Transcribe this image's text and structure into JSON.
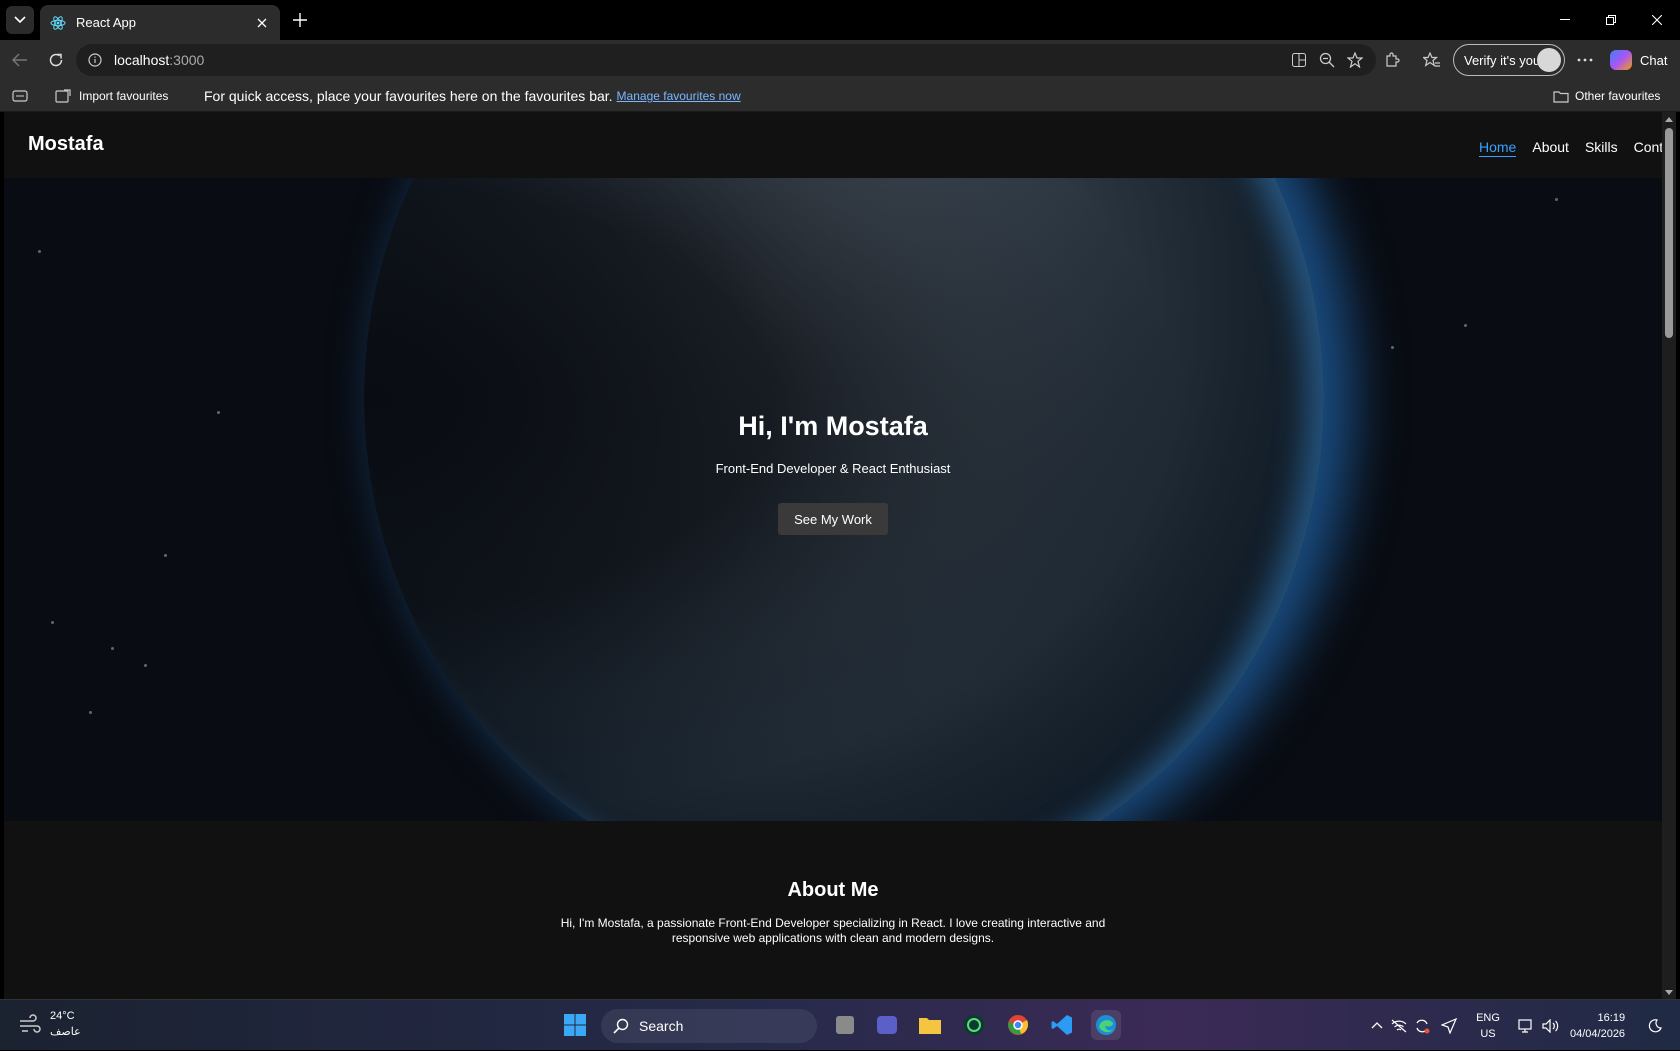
{
  "browser": {
    "tab_title": "React App",
    "url_host": "localhost",
    "url_port": ":3000",
    "verify_label": "Verify it's you",
    "chat_label": "Chat"
  },
  "favbar": {
    "import_label": "Import favourites",
    "message": "For quick access, place your favourites here on the favourites bar.",
    "manage_link": "Manage favourites now",
    "other_label": "Other favourites"
  },
  "page": {
    "brand": "Mostafa",
    "nav": [
      {
        "label": "Home",
        "active": true
      },
      {
        "label": "About",
        "active": false
      },
      {
        "label": "Skills",
        "active": false
      },
      {
        "label": "Contact",
        "active": false
      }
    ],
    "hero": {
      "title": "Hi, I'm Mostafa",
      "subtitle": "Front-End Developer & React Enthusiast",
      "cta": "See My Work"
    },
    "about": {
      "heading": "About Me",
      "text": "Hi, I'm Mostafa, a passionate Front-End Developer specializing in React. I love creating interactive and responsive web applications with clean and modern designs."
    }
  },
  "taskbar": {
    "weather_temp": "24°C",
    "weather_desc": "عاصف",
    "search_label": "Search",
    "lang_top": "ENG",
    "lang_bottom": "US",
    "time": "16:19",
    "date": "04/04/2026"
  },
  "colors": {
    "accent_link": "#3aa0ff",
    "page_bg": "#111111",
    "planet_glow": "#2882dc"
  },
  "icons": [
    "tab-list-icon",
    "react-icon",
    "close-icon",
    "plus-icon",
    "minimize-icon",
    "restore-icon",
    "back-icon",
    "reload-icon",
    "info-icon",
    "split-screen-icon",
    "zoom-icon",
    "star-icon",
    "extensions-icon",
    "favorites-icon",
    "more-icon",
    "copilot-icon",
    "import-icon",
    "folder-icon",
    "windows-icon",
    "search-icon",
    "chevron-up-icon",
    "wifi-off-icon",
    "sync-icon",
    "send-icon",
    "network-icon",
    "volume-icon",
    "moon-icon"
  ]
}
